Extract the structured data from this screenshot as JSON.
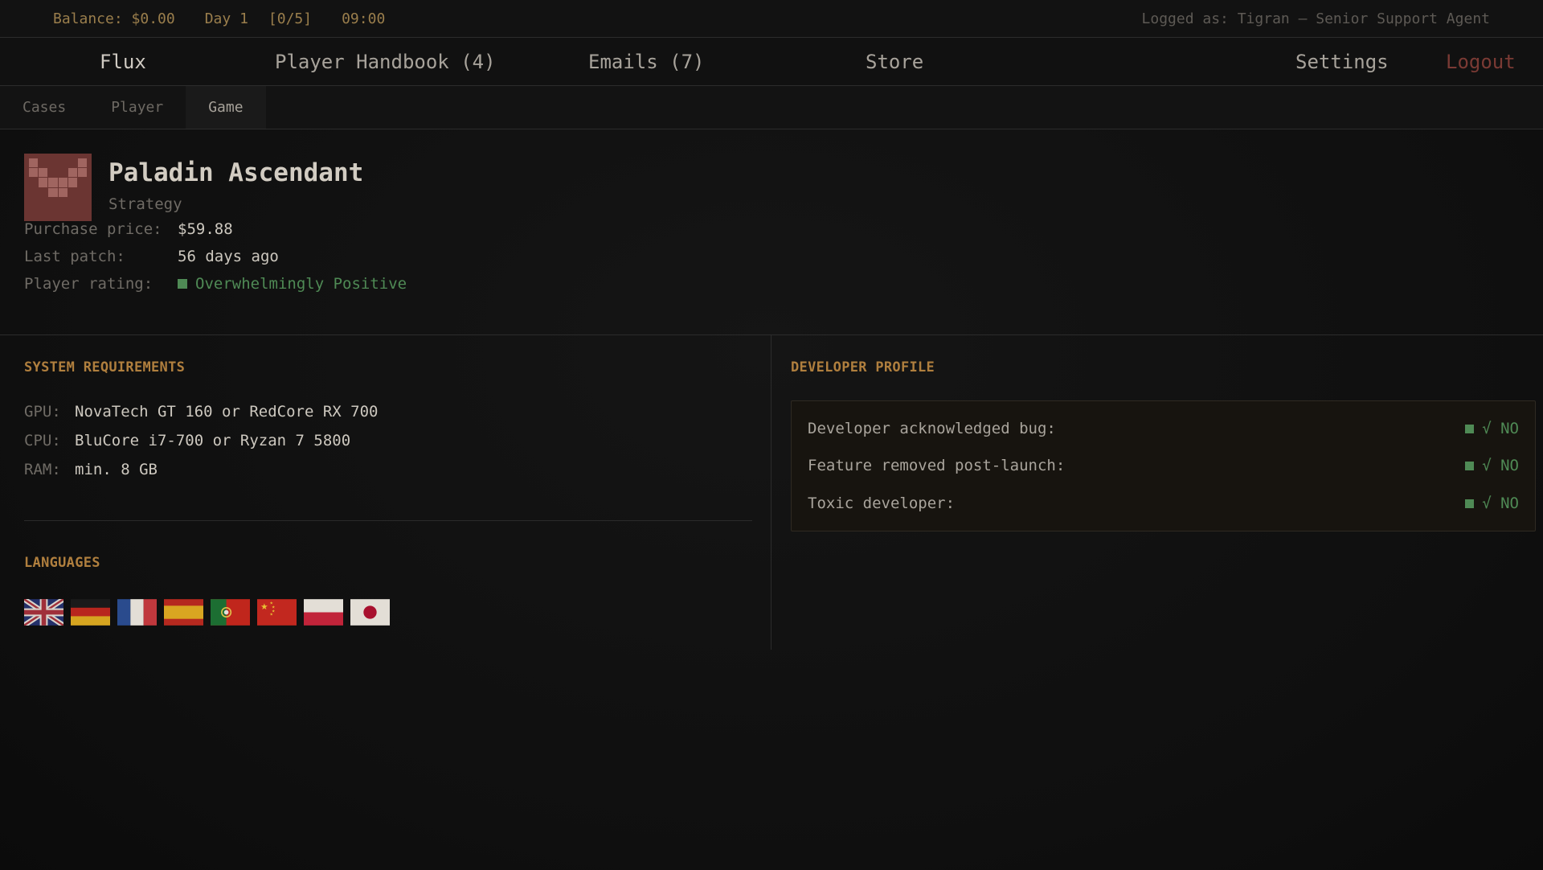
{
  "status": {
    "balance": "Balance: $0.00",
    "day": "Day 1",
    "cases": "[0/5]",
    "time": "09:00",
    "logged_as": "Logged as: Tigran — Senior Support Agent"
  },
  "nav": {
    "flux": "Flux",
    "handbook": "Player Handbook (4)",
    "emails": "Emails (7)",
    "store": "Store",
    "settings": "Settings",
    "logout": "Logout"
  },
  "subnav": {
    "cases": "Cases",
    "player": "Player",
    "game": "Game",
    "active": "Game"
  },
  "game": {
    "title": "Paladin Ascendant",
    "genre": "Strategy",
    "price_label": "Purchase price:",
    "price_value": "$59.88",
    "patch_label": "Last patch:",
    "patch_value": "56 days ago",
    "rating_label": "Player rating:",
    "rating_value": "Overwhelmingly Positive",
    "rating_color": "#4f8a55"
  },
  "system": {
    "title": "SYSTEM REQUIREMENTS",
    "gpu_label": "GPU:",
    "gpu_value": "NovaTech GT 160 or RedCore RX 700",
    "cpu_label": "CPU:",
    "cpu_value": "BluCore i7-700 or Ryzan 7 5800",
    "ram_label": "RAM:",
    "ram_value": "min. 8 GB"
  },
  "languages": {
    "title": "LANGUAGES",
    "flags": [
      "uk-flag-icon",
      "germany-flag-icon",
      "france-flag-icon",
      "spain-flag-icon",
      "portugal-flag-icon",
      "china-flag-icon",
      "poland-flag-icon",
      "japan-flag-icon"
    ]
  },
  "developer": {
    "title": "DEVELOPER PROFILE",
    "rows": [
      {
        "label": "Developer acknowledged bug:",
        "value": "√ NO"
      },
      {
        "label": "Feature removed post-launch:",
        "value": "√ NO"
      },
      {
        "label": "Toxic developer:",
        "value": "√ NO"
      }
    ]
  },
  "colors": {
    "accent_gold": "#b07f3e",
    "positive_green": "#4f8a55",
    "logout_red": "#7a3a34"
  }
}
